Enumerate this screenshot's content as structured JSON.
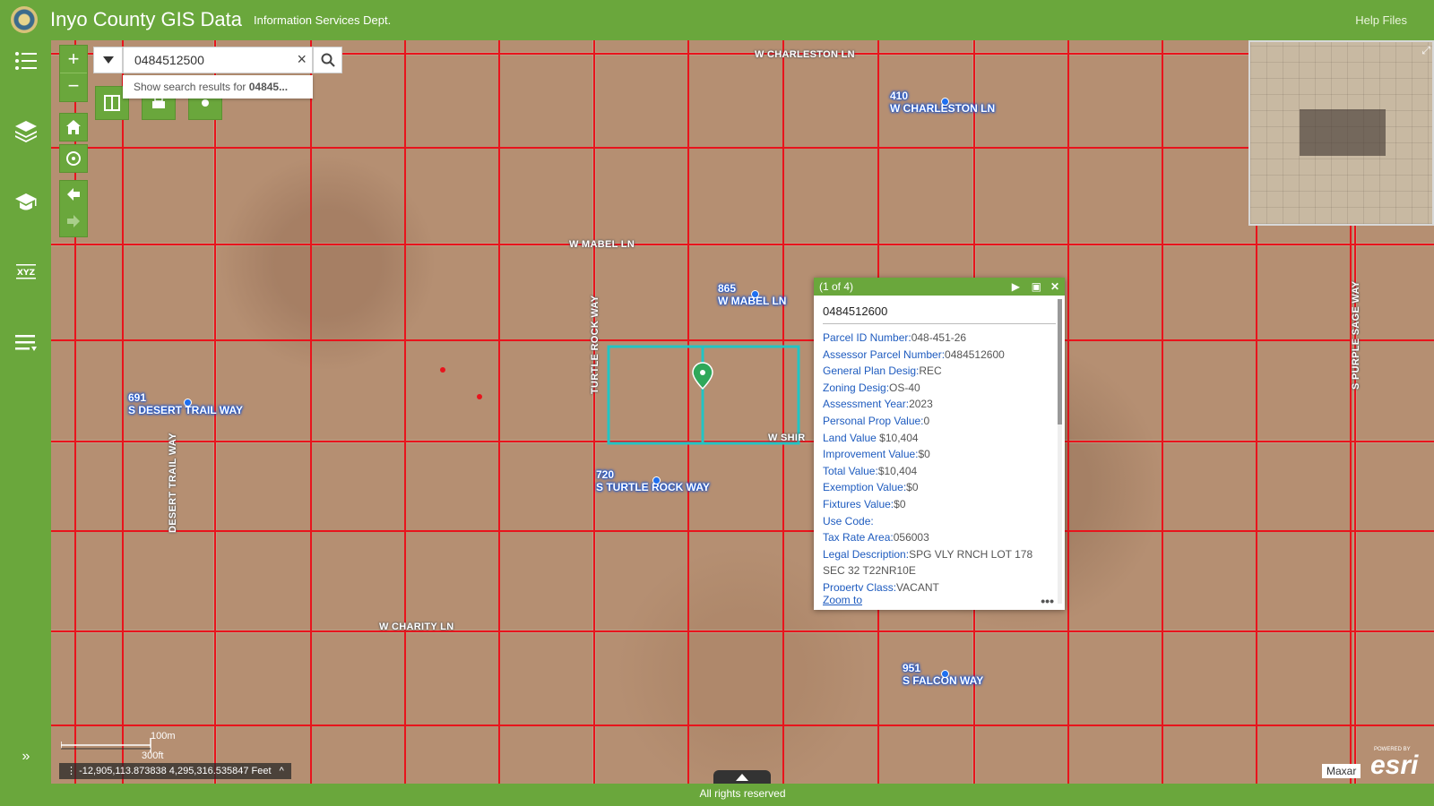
{
  "header": {
    "title": "Inyo County GIS Data",
    "subtitle": "Information Services Dept.",
    "help_link": "Help Files"
  },
  "sidebar": {
    "items": [
      {
        "icon": "list-icon",
        "glyph": "☰"
      },
      {
        "icon": "layers-icon",
        "glyph": "◈"
      },
      {
        "icon": "legend-icon",
        "glyph": "🎓"
      },
      {
        "icon": "xyz-icon",
        "glyph": "XYZ"
      },
      {
        "icon": "menu-icon",
        "glyph": "≡"
      }
    ],
    "expand_glyph": "»"
  },
  "search": {
    "value": "0484512500",
    "suggestion_prefix": "Show search results for ",
    "suggestion_query": "04845..."
  },
  "map": {
    "road_labels": [
      "W CHARLESTON LN",
      "W MABEL LN",
      "W CHARITY LN",
      "DESERT TRAIL WAY",
      "S PURPLE SAGE WAY",
      "TURTLE ROCK WAY",
      "W SHIR"
    ],
    "address_labels": [
      {
        "number": "410",
        "street": "W CHARLESTON LN"
      },
      {
        "number": "865",
        "street": "W MABEL LN"
      },
      {
        "number": "691",
        "street": "S DESERT TRAIL WAY"
      },
      {
        "number": "720",
        "street": "S TURTLE ROCK WAY"
      },
      {
        "number": "951",
        "street": "S FALCON WAY"
      }
    ],
    "parcel_line_color": "#e8141c",
    "selected_parcel_color": "#22c4c4"
  },
  "popup": {
    "counter": "(1 of 4)",
    "title": "0484512600",
    "fields": [
      {
        "key": "Parcel ID Number:",
        "value": "048-451-26"
      },
      {
        "key": "Assessor Parcel Number:",
        "value": "0484512600"
      },
      {
        "key": "General Plan Desig:",
        "value": "REC"
      },
      {
        "key": "Zoning Desig:",
        "value": "OS-40"
      },
      {
        "key": "Assessment Year:",
        "value": "2023"
      },
      {
        "key": "Personal Prop Value:",
        "value": "0"
      },
      {
        "key": "Land Value ",
        "value": "$10,404"
      },
      {
        "key": "Improvement Value:",
        "value": "$0"
      },
      {
        "key": "Total Value:",
        "value": "$10,404"
      },
      {
        "key": "Exemption Value:",
        "value": "$0"
      },
      {
        "key": "Fixtures Value:",
        "value": "$0"
      },
      {
        "key": "Use Code:",
        "value": ""
      },
      {
        "key": "Tax Rate Area:",
        "value": "056003"
      },
      {
        "key": "Legal Description:",
        "value": "SPG VLY RNCH LOT 178 SEC 32 T22NR10E"
      },
      {
        "key": "Property Class:",
        "value": "VACANT"
      }
    ],
    "zoom_to": "Zoom to",
    "more": "•••"
  },
  "scalebar": {
    "top_label": "100m",
    "bottom_label": "300ft"
  },
  "coordinates": "-12,905,113.873838 4,295,316.535847 Feet",
  "attribution": {
    "maxar": "Maxar",
    "powered_by": "POWERED BY",
    "esri": "esri"
  },
  "footer": {
    "text": "All rights reserved"
  }
}
